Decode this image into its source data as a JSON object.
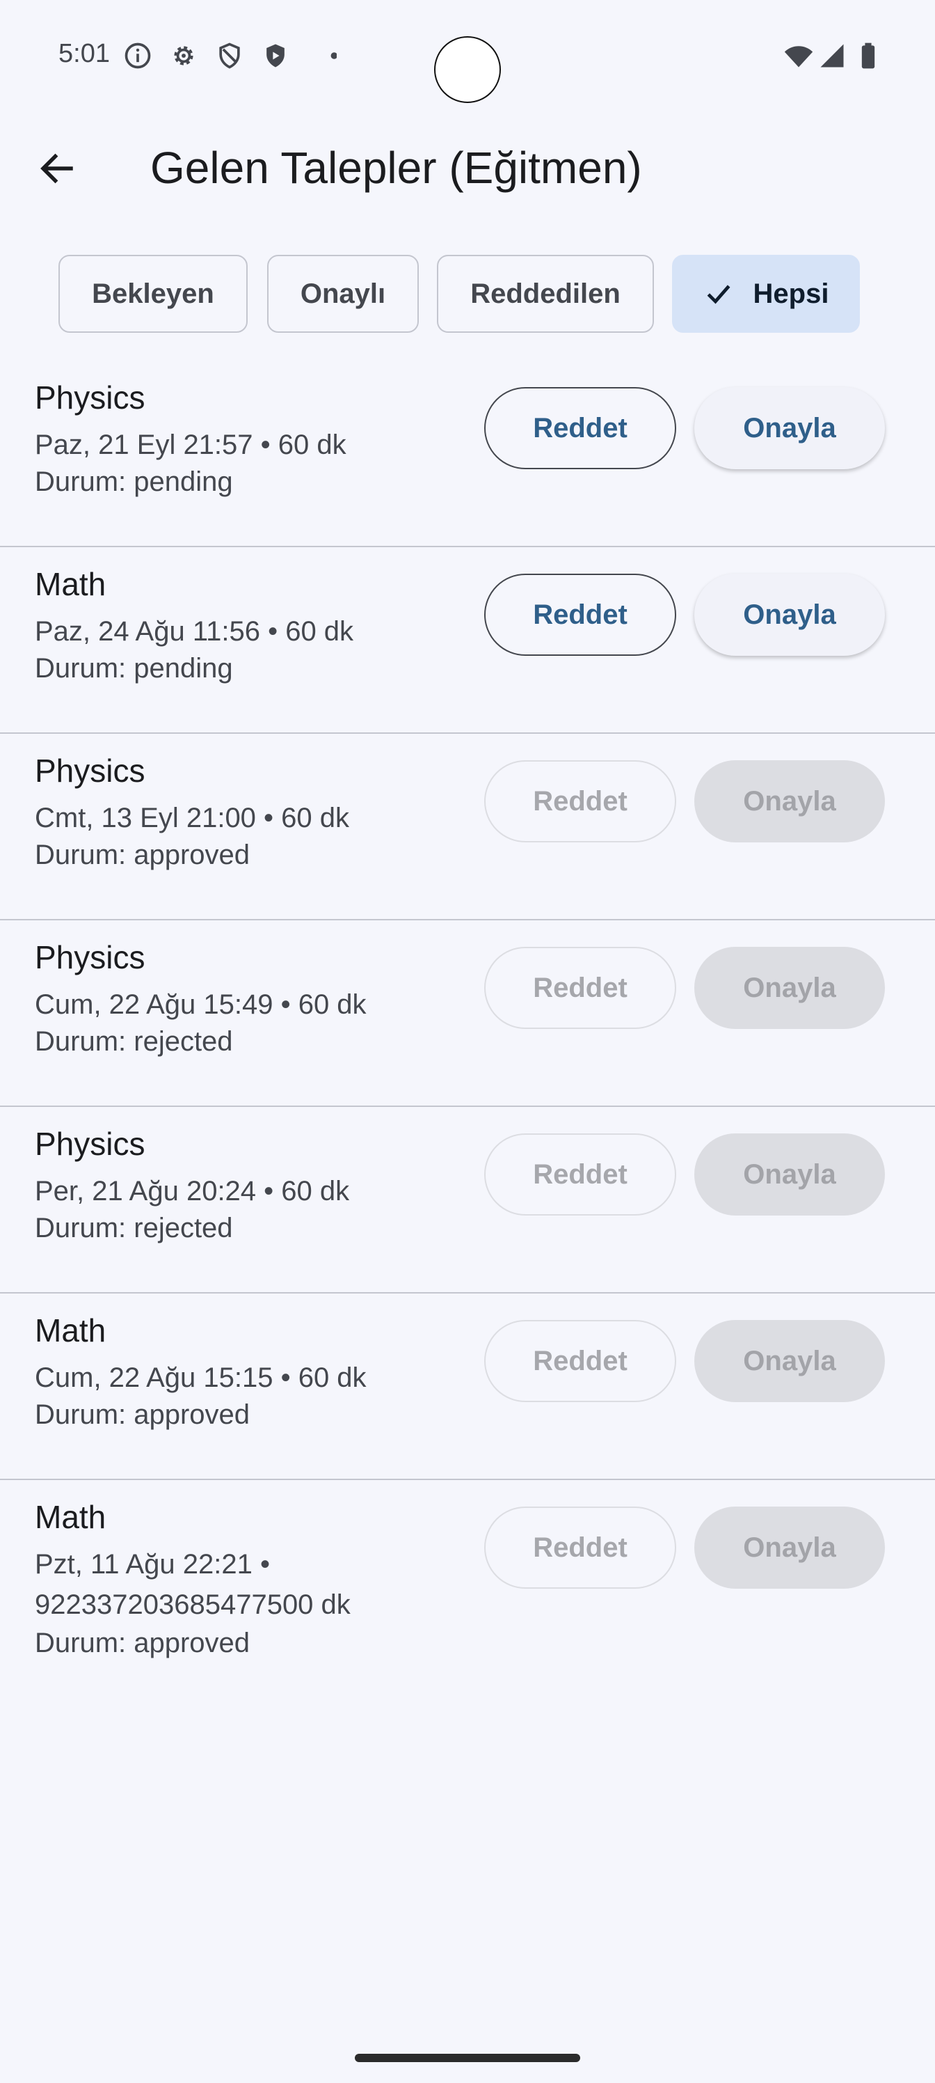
{
  "status_bar": {
    "time": "5:01",
    "left_icons": [
      "info-icon",
      "settings-icon",
      "shield-outline-icon",
      "shield-filled-icon",
      "dot-icon"
    ],
    "right_icons": [
      "wifi-icon",
      "signal-icon",
      "battery-icon"
    ]
  },
  "app_bar": {
    "back_icon": "arrow-back-icon",
    "title": "Gelen Talepler (Eğitmen)"
  },
  "filters": {
    "items": [
      {
        "label": "Bekleyen",
        "selected": false
      },
      {
        "label": "Onaylı",
        "selected": false
      },
      {
        "label": "Reddedilen",
        "selected": false
      },
      {
        "label": "Hepsi",
        "selected": true
      }
    ],
    "selected_icon": "check-icon"
  },
  "requests": [
    {
      "subject": "Physics",
      "when": "Paz, 21 Eyl 21:57 • 60 dk",
      "status": "Durum: pending",
      "reject_label": "Reddet",
      "approve_label": "Onayla",
      "actions_enabled": true
    },
    {
      "subject": "Math",
      "when": "Paz, 24 Ağu 11:56 • 60 dk",
      "status": "Durum: pending",
      "reject_label": "Reddet",
      "approve_label": "Onayla",
      "actions_enabled": true
    },
    {
      "subject": "Physics",
      "when": "Cmt, 13 Eyl 21:00 • 60 dk",
      "status": "Durum: approved",
      "reject_label": "Reddet",
      "approve_label": "Onayla",
      "actions_enabled": false
    },
    {
      "subject": "Physics",
      "when": "Cum, 22 Ağu 15:49 • 60 dk",
      "status": "Durum: rejected",
      "reject_label": "Reddet",
      "approve_label": "Onayla",
      "actions_enabled": false
    },
    {
      "subject": "Physics",
      "when": "Per, 21 Ağu 20:24 • 60 dk",
      "status": "Durum: rejected",
      "reject_label": "Reddet",
      "approve_label": "Onayla",
      "actions_enabled": false
    },
    {
      "subject": "Math",
      "when": "Cum, 22 Ağu 15:15 • 60 dk",
      "status": "Durum: approved",
      "reject_label": "Reddet",
      "approve_label": "Onayla",
      "actions_enabled": false
    },
    {
      "subject": "Math",
      "when": "Pzt, 11 Ağu 22:21 • 9223372036854775​00 dk",
      "status": "Durum: approved",
      "reject_label": "Reddet",
      "approve_label": "Onayla",
      "actions_enabled": false
    }
  ]
}
